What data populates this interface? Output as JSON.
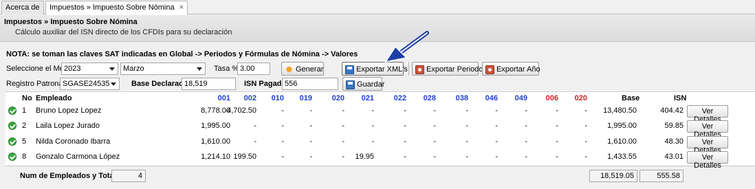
{
  "tabs": [
    {
      "label": "Acerca de"
    },
    {
      "label": "Impuestos » Impuesto Sobre Nómina",
      "close": "×"
    }
  ],
  "header": {
    "title": "Impuestos » Impuesto Sobre Nómina",
    "subtitle": "Cálculo auxiliar del ISN directo de los CFDIs para su declaración"
  },
  "nota": "NOTA: se toman las claves SAT indicadas en Global -> Periodos y Fórmulas de Nómina -> Valores",
  "form": {
    "mes_label": "Seleccione el Mes",
    "year": "2023",
    "month": "Marzo",
    "tasa_label": "Tasa %",
    "tasa": "3.00",
    "generar": "Generar",
    "exportar_xml": "Exportar XML's",
    "exportar_periodo": "Exportar Periodo",
    "exportar_anio": "Exportar Año",
    "registro_label": "Registro Patronal",
    "registro": "SGASE24535",
    "base_label": "Base Declarada",
    "base": "18,519",
    "isn_label": "ISN Pagado",
    "isn": "556",
    "guardar": "Guardar"
  },
  "table": {
    "headers": {
      "no": "No",
      "empleado": "Empleado",
      "codes": [
        "001",
        "002",
        "010",
        "019",
        "020",
        "021",
        "022",
        "028",
        "038",
        "046",
        "049",
        "006",
        "020"
      ],
      "base": "Base",
      "isn": "ISN"
    },
    "rows": [
      {
        "no": "1",
        "empleado": "Bruno Lopez Lopez",
        "values": [
          "8,778.00",
          "4,702.50",
          "-",
          "-",
          "-",
          "-",
          "-",
          "-",
          "-",
          "-",
          "-",
          "-",
          "-"
        ],
        "base": "13,480.50",
        "isn": "404.42",
        "action": "Ver Detalles"
      },
      {
        "no": "2",
        "empleado": "Laila Lopez Jurado",
        "values": [
          "1,995.00",
          "-",
          "-",
          "-",
          "-",
          "-",
          "-",
          "-",
          "-",
          "-",
          "-",
          "-",
          "-"
        ],
        "base": "1,995.00",
        "isn": "59.85",
        "action": "Ver Detalles"
      },
      {
        "no": "5",
        "empleado": "Nilda Coronado Ibarra",
        "values": [
          "1,610.00",
          "-",
          "-",
          "-",
          "-",
          "-",
          "-",
          "-",
          "-",
          "-",
          "-",
          "-",
          "-"
        ],
        "base": "1,610.00",
        "isn": "48.30",
        "action": "Ver Detalles"
      },
      {
        "no": "8",
        "empleado": "Gonzalo Carmona López",
        "values": [
          "1,214.10",
          "199.50",
          "-",
          "-",
          "-",
          "19.95",
          "-",
          "-",
          "-",
          "-",
          "-",
          "-",
          "-"
        ],
        "base": "1,433.55",
        "isn": "43.01",
        "action": "Ver Detalles"
      }
    ]
  },
  "footer": {
    "label": "Num de Empleados y Totales",
    "count": "4",
    "total_base": "18,519.05",
    "total_isn": "555.58"
  },
  "colors": {
    "code_blue": "#1f3fd0",
    "code_red": "#d01f1f",
    "status_green": "#35a83a"
  },
  "icons": {
    "generar": "gear-icon",
    "export": "export-icon",
    "save": "disk-icon",
    "status": "check-icon"
  }
}
